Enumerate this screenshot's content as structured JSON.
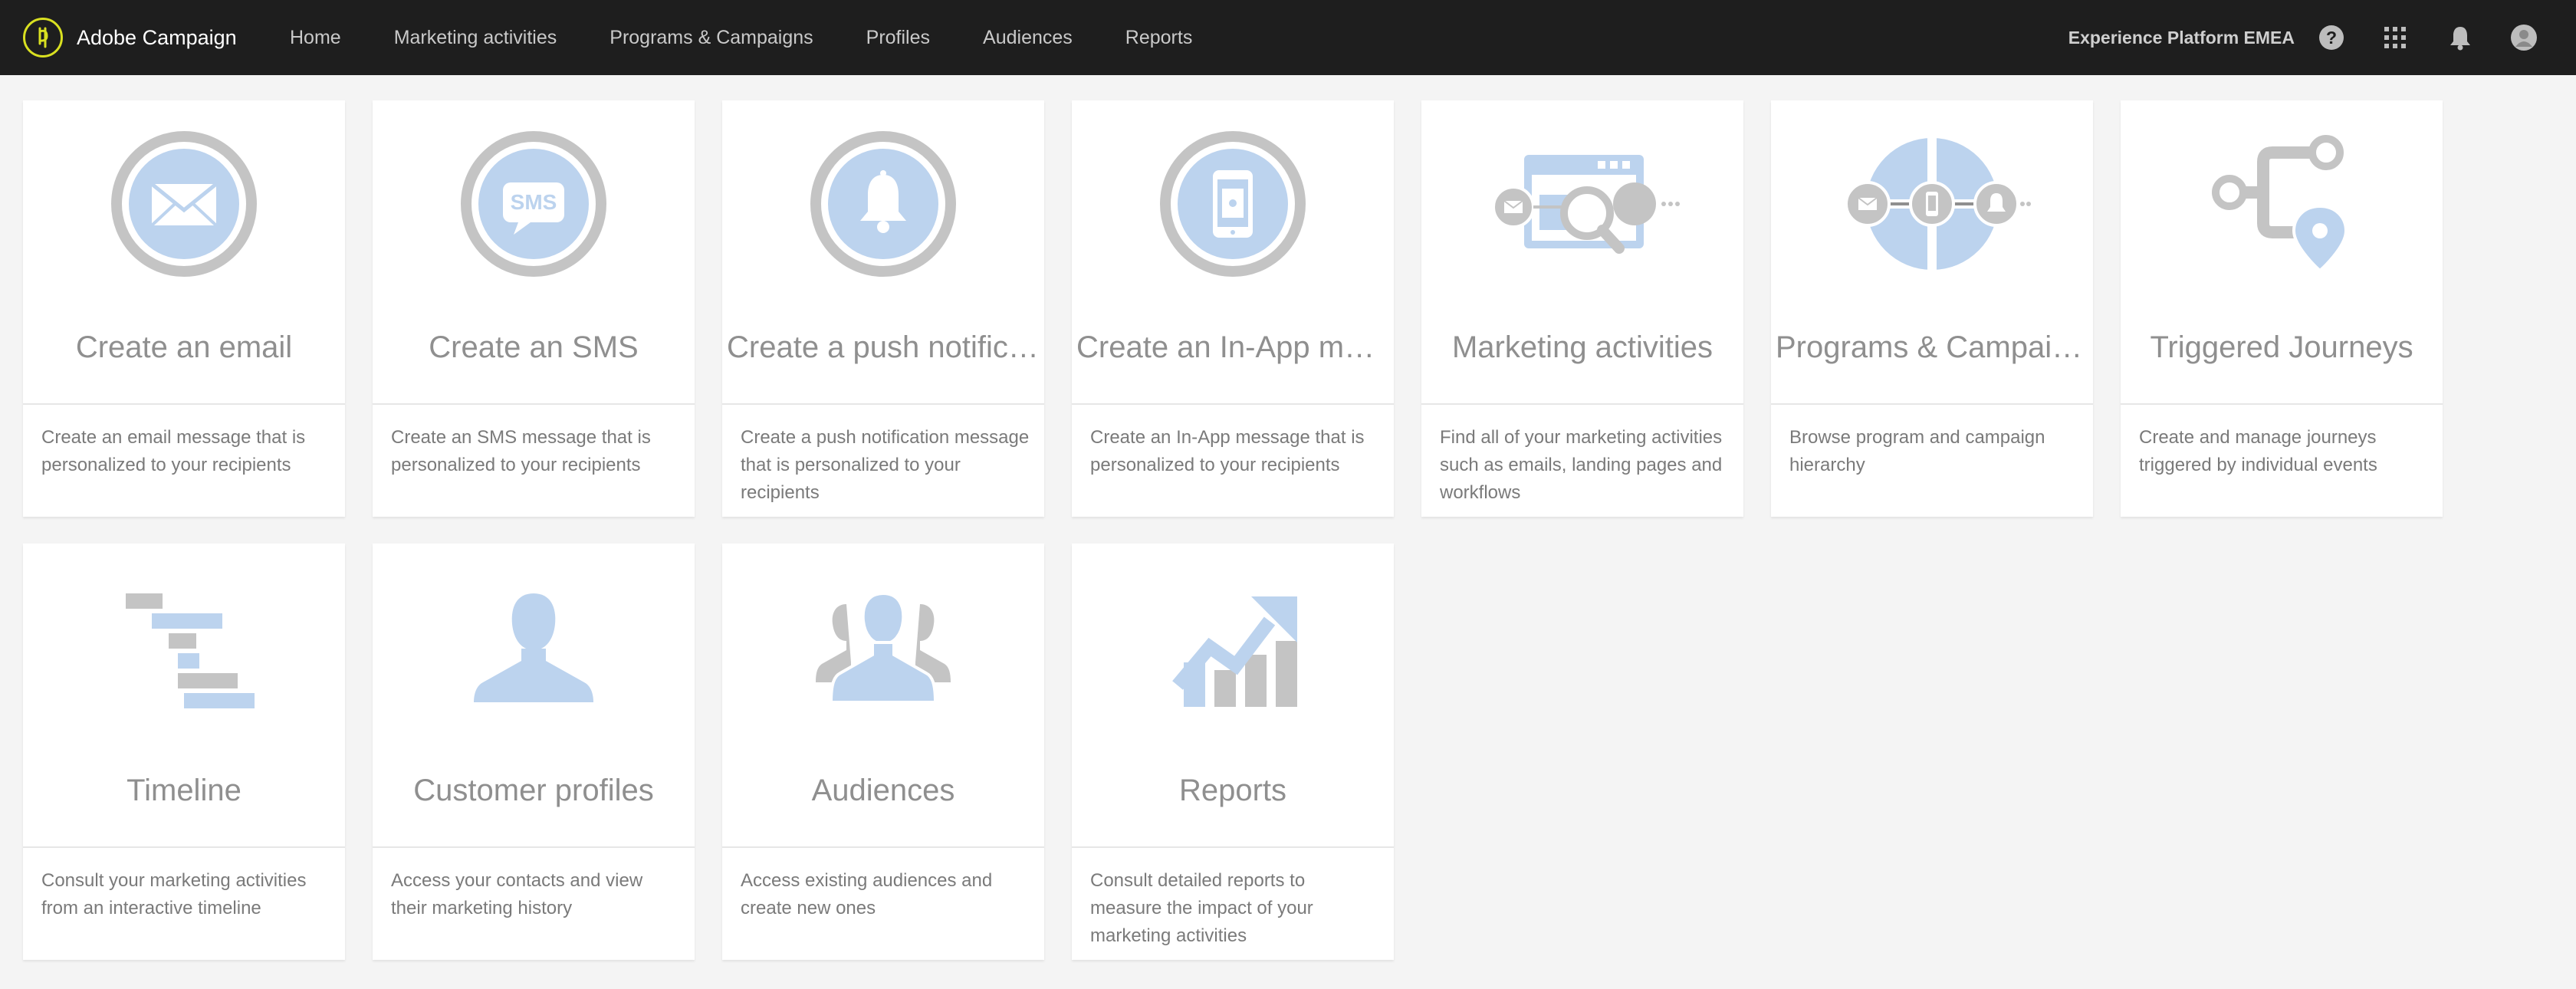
{
  "app": {
    "name": "Adobe Campaign"
  },
  "nav": {
    "items": [
      "Home",
      "Marketing activities",
      "Programs & Campaigns",
      "Profiles",
      "Audiences",
      "Reports"
    ]
  },
  "header": {
    "org_name": "Experience Platform EMEA"
  },
  "icons": {
    "help": "help-icon",
    "apps": "apps-grid-icon",
    "notifications": "bell-icon",
    "avatar": "user-avatar-icon"
  },
  "colors": {
    "accent_light_blue": "#bcd3ee",
    "gray": "#c4c4c4",
    "topbar": "#1e1e1e",
    "logo": "#d9e021"
  },
  "cards": [
    {
      "title": "Create an email",
      "desc": "Create an email message that is personalized to your recipients",
      "icon": "email-icon"
    },
    {
      "title": "Create an SMS",
      "desc": "Create an SMS message that is personalized to your recipients",
      "icon": "sms-icon",
      "icon_text": "SMS"
    },
    {
      "title": "Create a push notificat...",
      "desc": "Create a push notification message that is personalized to your recipients",
      "icon": "push-notification-icon"
    },
    {
      "title": "Create an In-App mes...",
      "desc": "Create an In-App message that is personalized to your recipients",
      "icon": "in-app-message-icon"
    },
    {
      "title": "Marketing activities",
      "desc": "Find all of your marketing activities such as emails, landing pages and workflows",
      "icon": "marketing-activities-icon"
    },
    {
      "title": "Programs & Campaigns",
      "desc": "Browse program and campaign hierarchy",
      "icon": "programs-campaigns-icon"
    },
    {
      "title": "Triggered Journeys",
      "desc": "Create and manage journeys triggered by individual events",
      "icon": "triggered-journeys-icon"
    },
    {
      "title": "Timeline",
      "desc": "Consult your marketing activities from an interactive timeline",
      "icon": "timeline-icon"
    },
    {
      "title": "Customer profiles",
      "desc": "Access your contacts and view their marketing history",
      "icon": "customer-profile-icon"
    },
    {
      "title": "Audiences",
      "desc": "Access existing audiences and create new ones",
      "icon": "audiences-icon"
    },
    {
      "title": "Reports",
      "desc": "Consult detailed reports to measure the impact of your marketing activities",
      "icon": "reports-icon"
    }
  ]
}
